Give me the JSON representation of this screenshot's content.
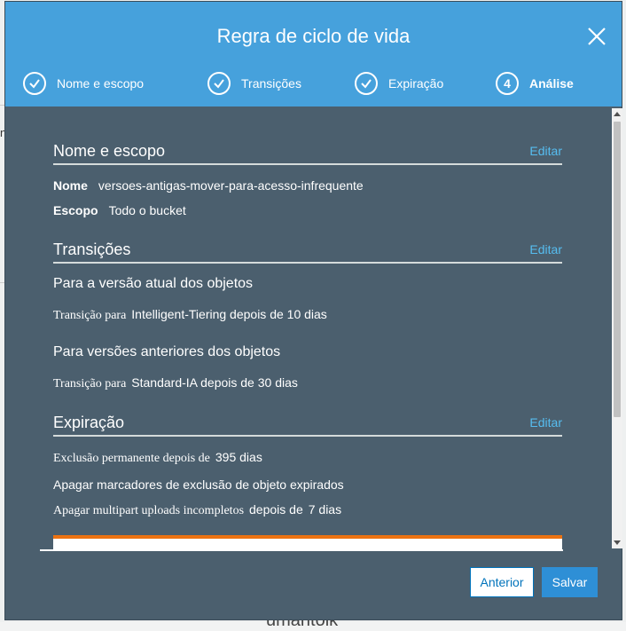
{
  "background": {
    "footer_fragment": "umántolk"
  },
  "dialog": {
    "title": "Regra de ciclo de vida",
    "steps": [
      {
        "label": "Nome e escopo",
        "state": "done"
      },
      {
        "label": "Transições",
        "state": "done"
      },
      {
        "label": "Expiração",
        "state": "done"
      },
      {
        "label": "Análise",
        "state": "active",
        "number": "4"
      }
    ]
  },
  "review": {
    "name_scope": {
      "title": "Nome e escopo",
      "edit": "Editar",
      "name_label": "Nome",
      "name_value": "versoes-antigas-mover-para-acesso-infrequente",
      "scope_label": "Escopo",
      "scope_value": "Todo o bucket"
    },
    "transitions": {
      "title": "Transições",
      "edit": "Editar",
      "current_heading": "Para a versão atual dos objetos",
      "current_prefix": "Transição para",
      "current_value": "Intelligent-Tiering depois de 10 dias",
      "previous_heading": "Para versões anteriores dos objetos",
      "previous_prefix": "Transição para",
      "previous_value": "Standard-IA depois de 30 dias"
    },
    "expiration": {
      "title": "Expiração",
      "edit": "Editar",
      "permanent_prefix": "Exclusão permanente depois de",
      "permanent_value": "395 dias",
      "markers_text": "Apagar marcadores de exclusão de objeto expirados",
      "multipart_prefix": "Apagar multipart uploads incompletos",
      "multipart_mid": "depois de",
      "multipart_value": "7 dias"
    }
  },
  "footer": {
    "previous": "Anterior",
    "save": "Salvar"
  },
  "colors": {
    "header": "#46a1dc",
    "body": "#4b5f6e",
    "link": "#56bdf0",
    "accent": "#ec7211",
    "primary": "#2e8fd6"
  }
}
